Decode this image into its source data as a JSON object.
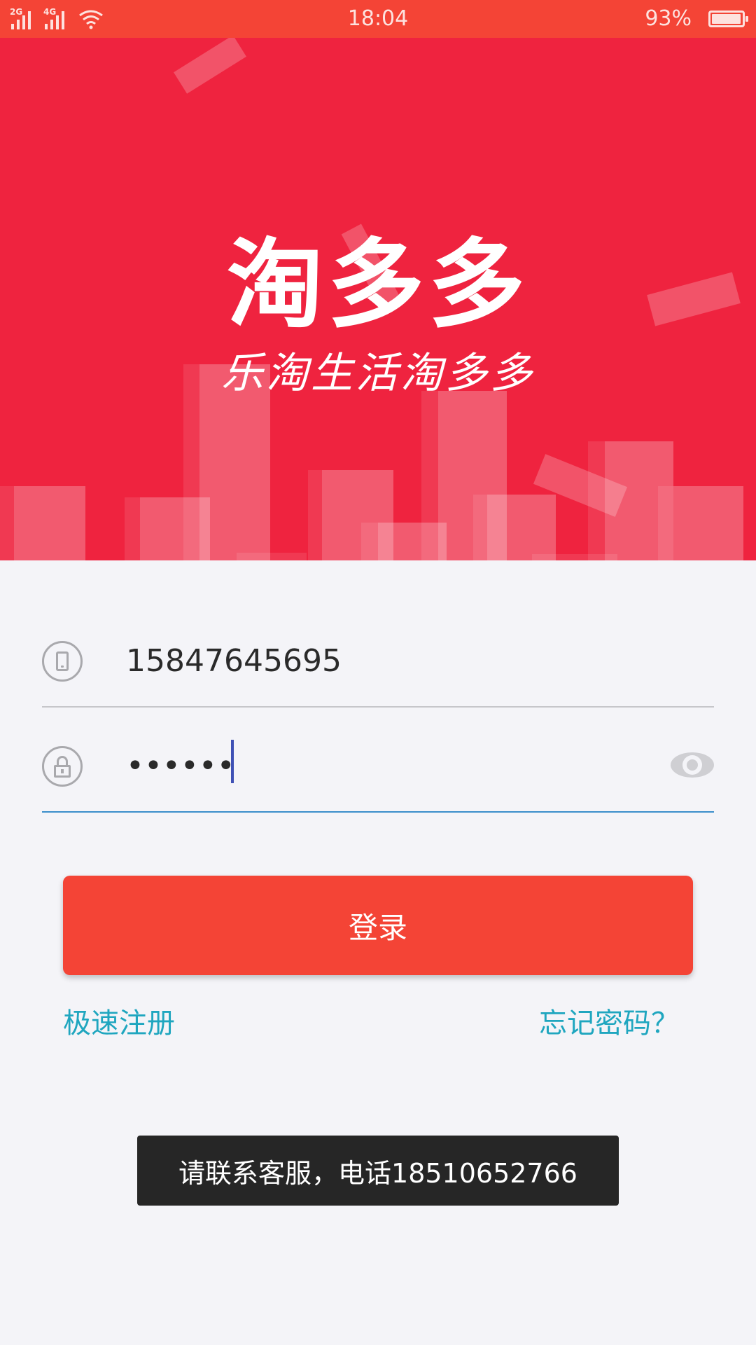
{
  "status_bar": {
    "signal1_label": "2G",
    "signal2_label": "4G",
    "time": "18:04",
    "battery_text": "93%",
    "battery_level": 0.93
  },
  "banner": {
    "logo": "淘多多",
    "slogan": "乐淘生活淘多多"
  },
  "login_form": {
    "phone_value": "15847645695",
    "password_masked": "••••••"
  },
  "login_button_label": "登录",
  "register_link": "极速注册",
  "forgot_link": "忘记密码？",
  "toast": "请联系客服，电话18510652766",
  "colors": {
    "primary": "#f44436",
    "banner": "#ef233f",
    "link": "#1fa6bf",
    "focus_underline": "#3b8ecb"
  }
}
